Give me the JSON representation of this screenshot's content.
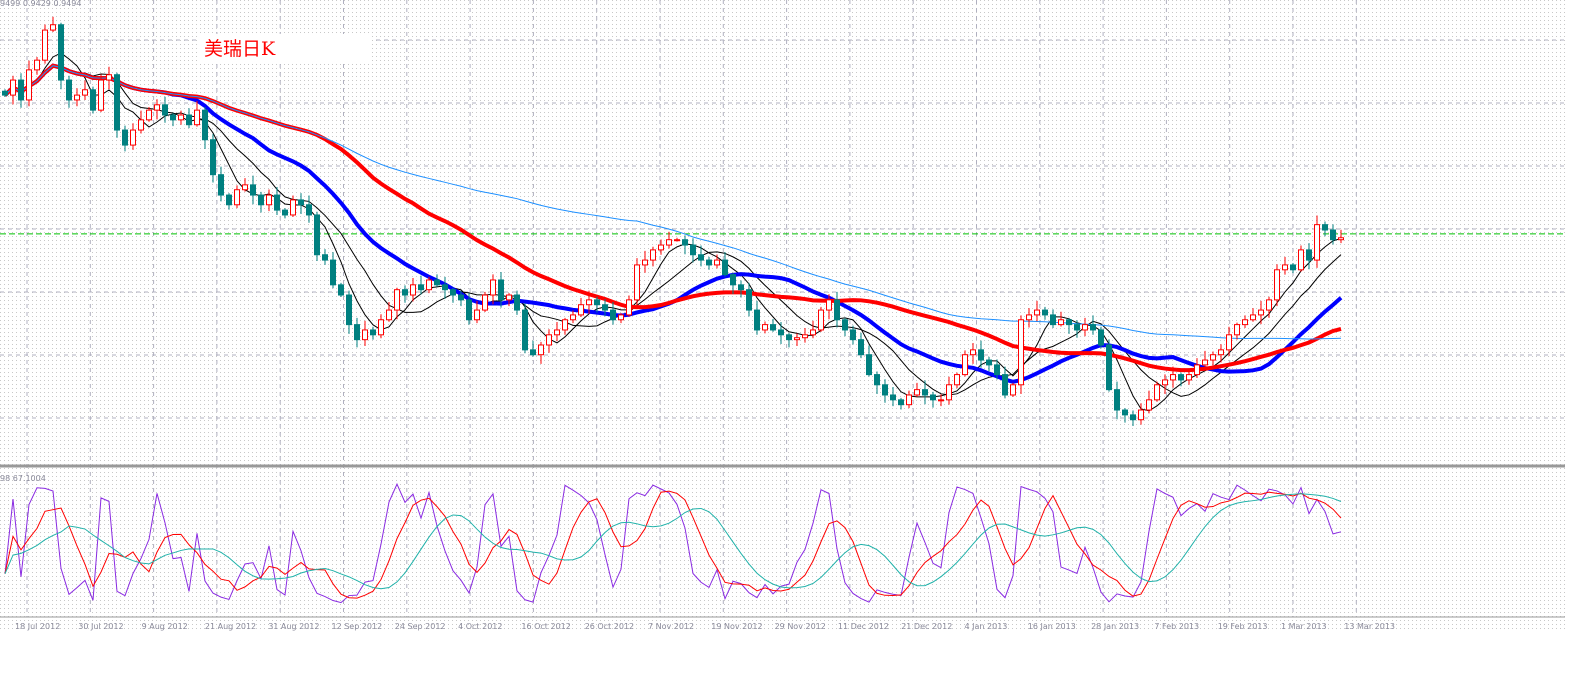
{
  "chart_data": {
    "type": "candlestick",
    "title": "美瑞日K",
    "price_readout": "9499 0.9429 0.9494",
    "oscillator_readout": "98 67.1004",
    "current_price_line": 0.9494,
    "ylim": [
      0.9028,
      0.9976
    ],
    "oscillator_ylim": [
      0,
      100
    ],
    "x_tick_labels": [
      "18 Jul 2012",
      "30 Jul 2012",
      "9 Aug 2012",
      "21 Aug 2012",
      "31 Aug 2012",
      "12 Sep 2012",
      "24 Sep 2012",
      "4 Oct 2012",
      "16 Oct 2012",
      "26 Oct 2012",
      "7 Nov 2012",
      "19 Nov 2012",
      "29 Nov 2012",
      "11 Dec 2012",
      "21 Dec 2012",
      "4 Jan 2013",
      "16 Jan 2013",
      "28 Jan 2013",
      "7 Feb 2013",
      "19 Feb 2013",
      "1 Mar 2013",
      "13 Mar 2013"
    ],
    "closes": [
      0.978,
      0.9811,
      0.977,
      0.9832,
      0.9852,
      0.9914,
      0.9925,
      0.9811,
      0.977,
      0.978,
      0.9791,
      0.9749,
      0.9811,
      0.9822,
      0.9708,
      0.9677,
      0.9708,
      0.9729,
      0.9749,
      0.976,
      0.9739,
      0.9729,
      0.9739,
      0.9719,
      0.9749,
      0.9688,
      0.9616,
      0.9574,
      0.9554,
      0.9585,
      0.9595,
      0.9574,
      0.9554,
      0.9574,
      0.9543,
      0.9533,
      0.9564,
      0.9554,
      0.9533,
      0.9451,
      0.944,
      0.9389,
      0.9368,
      0.9307,
      0.9276,
      0.9296,
      0.9286,
      0.9317,
      0.9337,
      0.9379,
      0.9368,
      0.9389,
      0.9379,
      0.9399,
      0.9389,
      0.9379,
      0.9368,
      0.9358,
      0.9317,
      0.9337,
      0.9368,
      0.9399,
      0.9358,
      0.9368,
      0.9337,
      0.9255,
      0.9245,
      0.9265,
      0.9286,
      0.9296,
      0.9317,
      0.9327,
      0.9348,
      0.9358,
      0.9348,
      0.9337,
      0.9317,
      0.9327,
      0.9358,
      0.943,
      0.944,
      0.9461,
      0.9471,
      0.9482,
      0.9482,
      0.9471,
      0.9451,
      0.944,
      0.943,
      0.944,
      0.941,
      0.9389,
      0.9379,
      0.9337,
      0.9296,
      0.9307,
      0.9296,
      0.9286,
      0.9276,
      0.928,
      0.9286,
      0.9296,
      0.9337,
      0.9358,
      0.9317,
      0.9296,
      0.9276,
      0.9245,
      0.9204,
      0.9183,
      0.9162,
      0.9152,
      0.9142,
      0.9162,
      0.9173,
      0.9162,
      0.9152,
      0.9152,
      0.9183,
      0.9204,
      0.9245,
      0.9255,
      0.9234,
      0.9224,
      0.9204,
      0.9162,
      0.9183,
      0.9317,
      0.9327,
      0.9337,
      0.9327,
      0.9307,
      0.9317,
      0.9307,
      0.9296,
      0.9307,
      0.9296,
      0.9265,
      0.9173,
      0.9131,
      0.9121,
      0.9111,
      0.9131,
      0.9152,
      0.9183,
      0.9193,
      0.9204,
      0.9193,
      0.9204,
      0.9224,
      0.9234,
      0.9245,
      0.9255,
      0.9286,
      0.9307,
      0.9317,
      0.9327,
      0.9337,
      0.9358,
      0.942,
      0.943,
      0.942,
      0.9461,
      0.944,
      0.9513,
      0.9502,
      0.9482,
      0.9486
    ],
    "moving_averages": [
      {
        "period": 5,
        "color": "#000000"
      },
      {
        "period": 10,
        "color": "#000000"
      },
      {
        "period": 20,
        "color": "#0000ff"
      },
      {
        "period": 40,
        "color": "#ff0000"
      },
      {
        "period": 80,
        "color": "#1e90ff"
      }
    ],
    "stochastic": {
      "k_period": 5,
      "d_period": 5,
      "slow_period": 8,
      "colors": [
        "#8a2be2",
        "#ff0000",
        "#20b2aa"
      ]
    },
    "colors": {
      "up": "#ff0000",
      "down": "#008080",
      "price_line": "#00c000"
    }
  }
}
